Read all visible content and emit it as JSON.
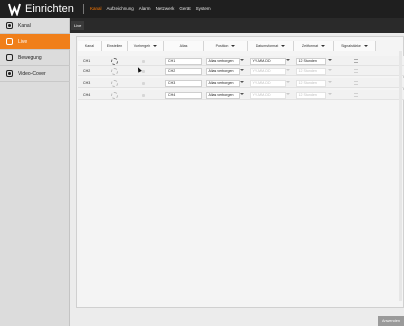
{
  "app": {
    "title": "Einrichten",
    "nav": [
      "Kanal",
      "Aufzeichnung",
      "Alarm",
      "Netzwerk",
      "Gerät",
      "System"
    ],
    "nav_active_index": 0
  },
  "sub_tabs": [
    "Live"
  ],
  "sidebar": {
    "items": [
      {
        "label": "Kanal",
        "icon": "camera-icon",
        "active": false
      },
      {
        "label": "Live",
        "icon": "live-icon",
        "active": true
      },
      {
        "label": "Bewegung",
        "icon": "motion-icon",
        "active": false
      },
      {
        "label": "Video-Cover",
        "icon": "video-cover-icon",
        "active": false
      }
    ]
  },
  "table": {
    "headers": [
      "Kanal",
      "Einstellen",
      "Vorhergeh",
      "Alias",
      "Position",
      "Datumsformat",
      "Zeitformat",
      "Signalstärke"
    ],
    "rows": [
      {
        "channel": "CH1",
        "alias": "CH1",
        "position": "Alias verborgen",
        "date_format": "YY-MM-DD",
        "time_format": "12 Stunden",
        "enabled": true
      },
      {
        "channel": "CH2",
        "alias": "CH2",
        "position": "Alias verborgen",
        "date_format": "YY-MM-DD",
        "time_format": "12 Stunden",
        "enabled": false
      },
      {
        "channel": "CH3",
        "alias": "CH3",
        "position": "Alias verborgen",
        "date_format": "YY-MM-DD",
        "time_format": "12 Stunden",
        "enabled": false
      },
      {
        "channel": "CH4",
        "alias": "CH4",
        "position": "Alias verborgen",
        "date_format": "YY-MM-DD",
        "time_format": "12 Stunden",
        "enabled": false
      }
    ]
  },
  "footer": {
    "apply_label": "Anwenden"
  },
  "colors": {
    "accent": "#f07f1a",
    "topbar": "#1f1f1f"
  }
}
